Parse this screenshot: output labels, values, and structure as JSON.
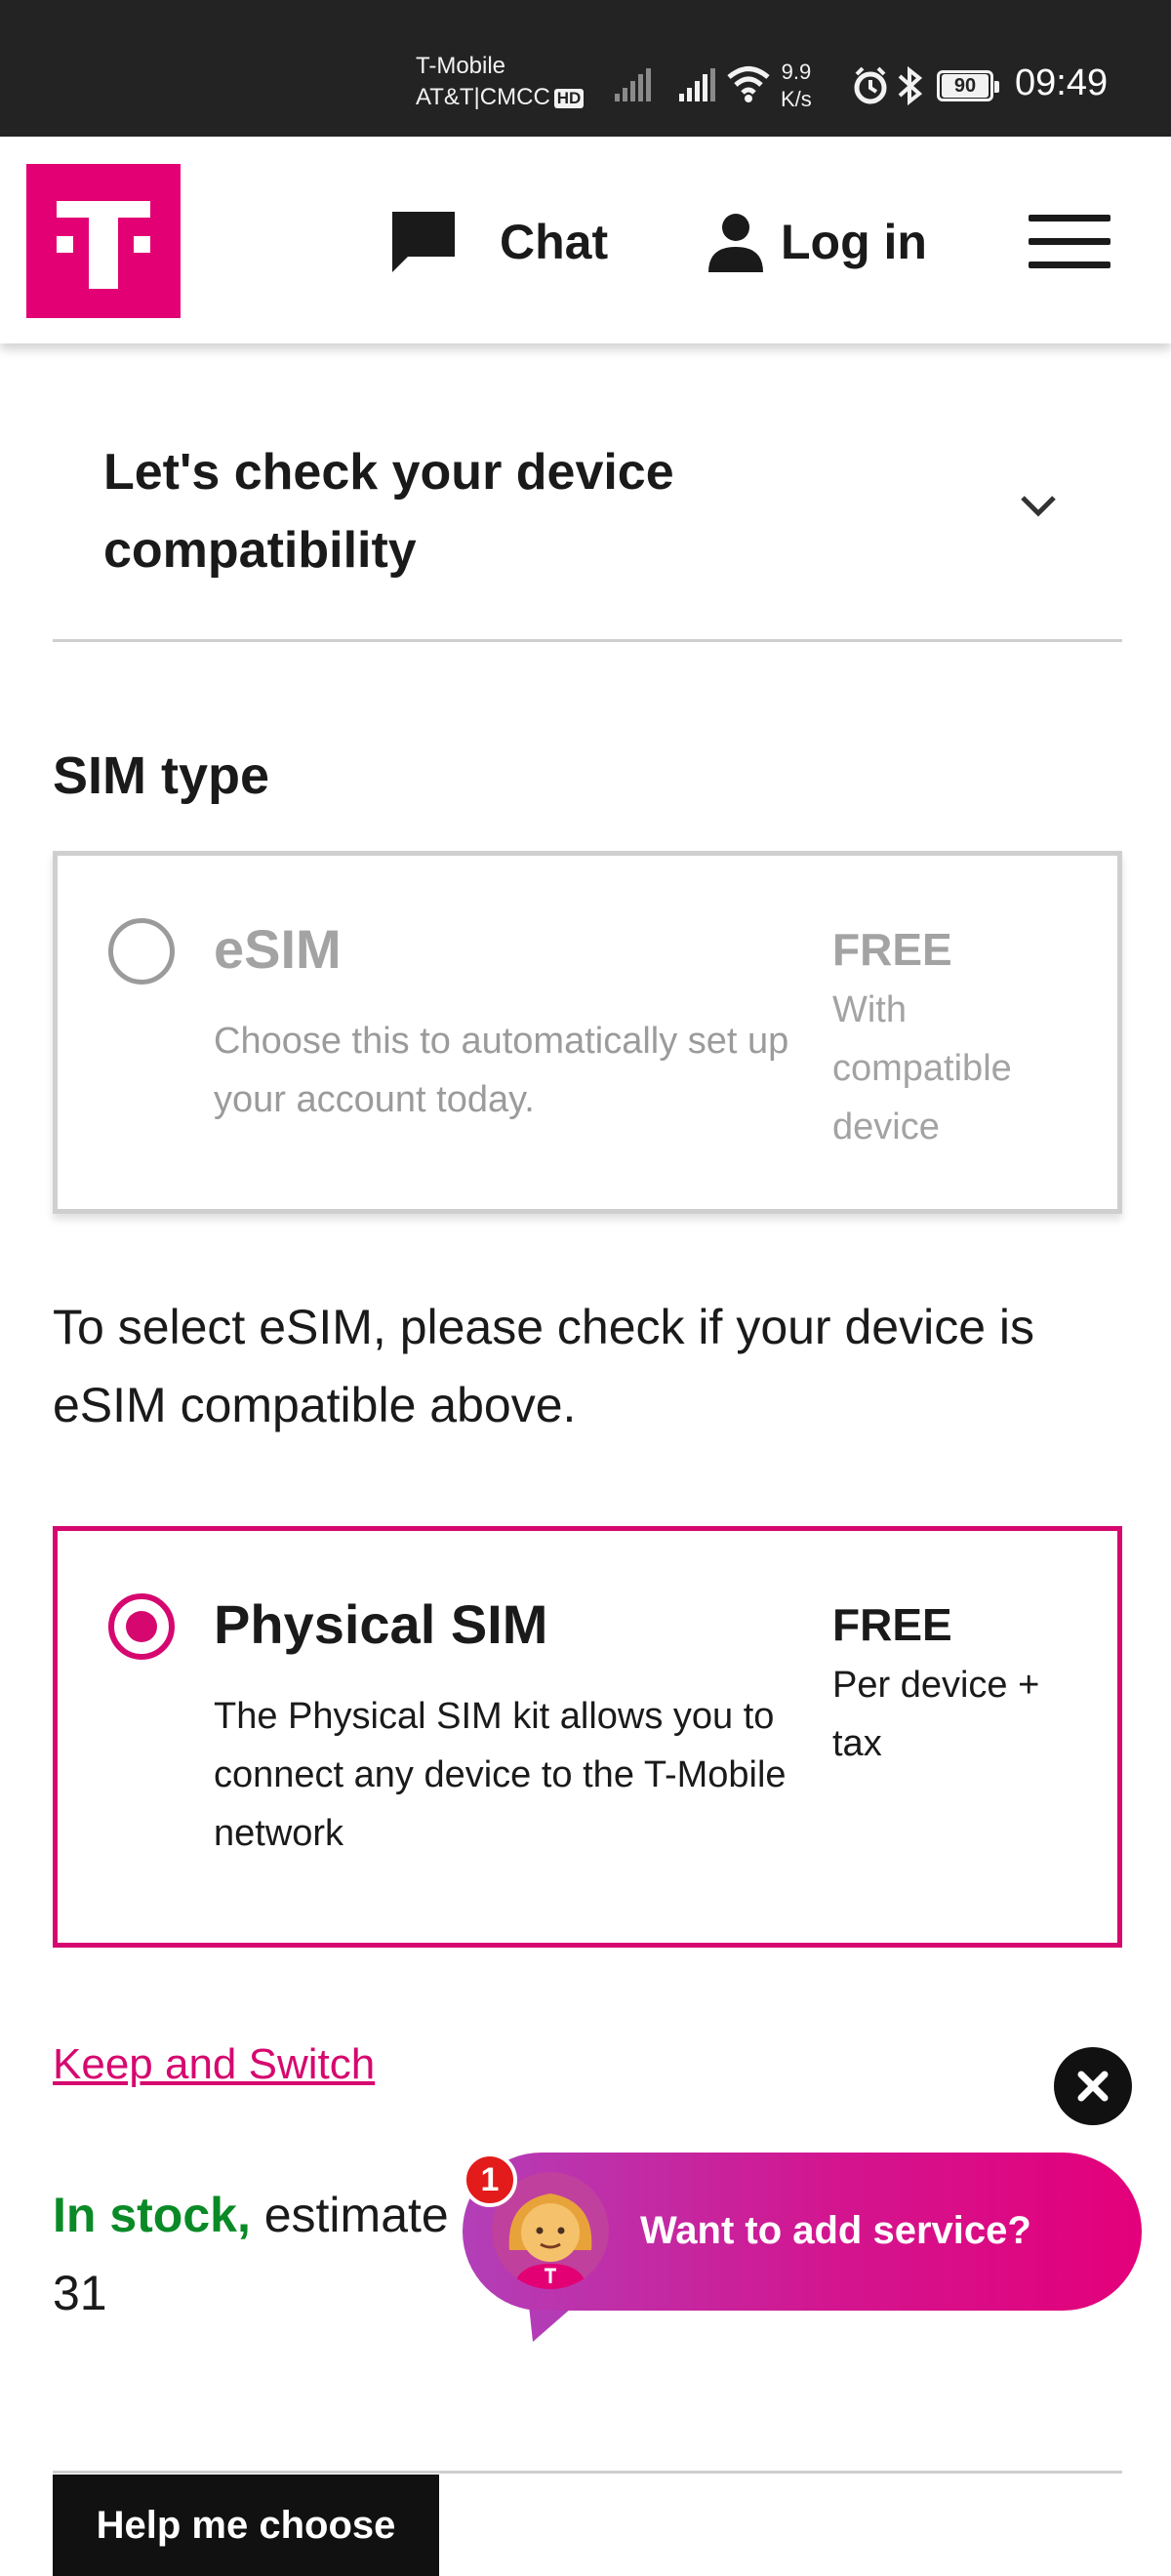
{
  "status_bar": {
    "carrier_line1": "T-Mobile",
    "carrier_line2": "AT&T|CMCC",
    "hd_badge": "HD",
    "speed_value": "9.9",
    "speed_unit": "K/s",
    "battery": "90",
    "time": "09:49"
  },
  "header": {
    "logo_letter": "T",
    "chat_label": "Chat",
    "login_label": "Log in",
    "brand_color": "#e20074"
  },
  "compatibility": {
    "title": "Let's check your device compatibility"
  },
  "sim_section": {
    "heading": "SIM type",
    "esim": {
      "title": "eSIM",
      "description": "Choose this to automatically set up your account today.",
      "price": "FREE",
      "price_note": "With compatible device",
      "selected": false
    },
    "esim_note": "To select eSIM, please check if your device is eSIM compatible above.",
    "physical": {
      "title": "Physical SIM",
      "description": "The Physical SIM kit allows you to connect any device to the T-Mobile network",
      "price": "FREE",
      "price_note": "Per device + tax",
      "selected": true
    }
  },
  "keep_switch_link": "Keep and Switch",
  "stock": {
    "status": "In stock,",
    "estimate": " estimate",
    "date_tail": "31"
  },
  "chat_prompt": {
    "badge_count": "1",
    "text": "Want to add service?"
  },
  "help_button": "Help me choose"
}
